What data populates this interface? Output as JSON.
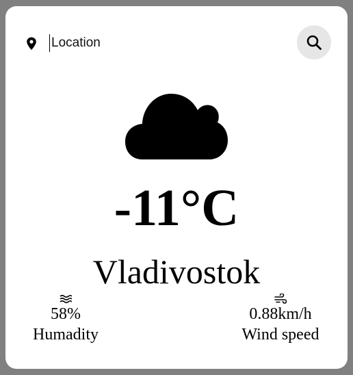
{
  "search": {
    "placeholder": "Location"
  },
  "icons": {
    "location": "map-pin-icon",
    "search": "magnifier-icon",
    "weather": "cloud-icon",
    "humidity": "waves-icon",
    "wind": "wind-icon"
  },
  "weather": {
    "temperature": "-11°C",
    "city": "Vladivostok"
  },
  "stats": {
    "humidity": {
      "value": "58%",
      "label": "Humadity"
    },
    "wind": {
      "value": "0.88km/h",
      "label": "Wind speed"
    }
  },
  "colors": {
    "page_background": "#808080",
    "card_background": "#ffffff",
    "search_button_background": "#e6e6e6",
    "text": "#000000"
  }
}
